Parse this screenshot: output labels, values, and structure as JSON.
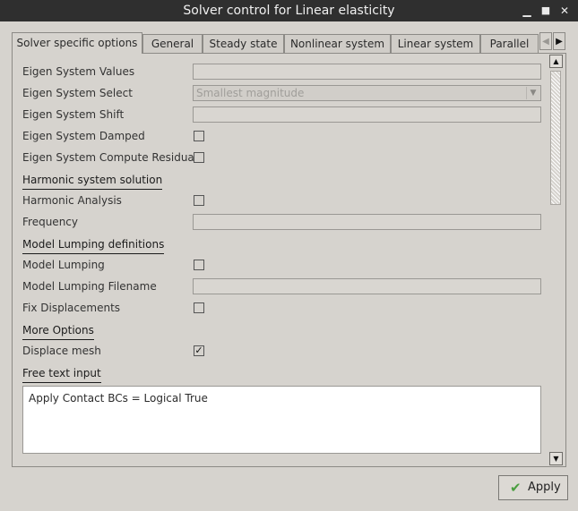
{
  "window": {
    "title": "Solver control for Linear elasticity",
    "minimize_icon": "minimize-icon",
    "maximize_icon": "maximize-icon",
    "close_icon": "close-icon"
  },
  "tabs": [
    {
      "label": "Solver specific options",
      "active": true
    },
    {
      "label": "General"
    },
    {
      "label": "Steady state"
    },
    {
      "label": "Nonlinear system"
    },
    {
      "label": "Linear system"
    },
    {
      "label": "Parallel"
    }
  ],
  "tab_scroll": {
    "left_icon": "arrow-left-icon",
    "right_icon": "arrow-right-icon"
  },
  "form": {
    "eigen_values_label": "Eigen System Values",
    "eigen_values_value": "",
    "eigen_select_label": "Eigen System Select",
    "eigen_select_value": "Smallest magnitude",
    "eigen_shift_label": "Eigen System Shift",
    "eigen_shift_value": "",
    "eigen_damped_label": "Eigen System Damped",
    "eigen_damped_checked": false,
    "eigen_residuals_label": "Eigen System Compute Residuals",
    "eigen_residuals_checked": false,
    "harmonic_section": "Harmonic system solution",
    "harmonic_analysis_label": "Harmonic Analysis",
    "harmonic_analysis_checked": false,
    "frequency_label": "Frequency",
    "frequency_value": "",
    "lumping_section": "Model Lumping definitions",
    "model_lumping_label": "Model Lumping",
    "model_lumping_checked": false,
    "lumping_filename_label": "Model Lumping Filename",
    "lumping_filename_value": "",
    "fix_displacements_label": "Fix Displacements",
    "fix_displacements_checked": false,
    "more_section": "More Options",
    "displace_mesh_label": "Displace mesh",
    "displace_mesh_checked": true,
    "free_text_section": "Free text input",
    "free_text_value": "Apply Contact BCs = Logical True"
  },
  "scrollbar": {
    "position_fraction": 0.0
  },
  "buttons": {
    "apply_label": "Apply",
    "apply_icon": "checkmark-icon"
  },
  "colors": {
    "titlebar": "#2f2f2f",
    "background": "#d6d3ce",
    "check_green": "#4a9e3f"
  }
}
